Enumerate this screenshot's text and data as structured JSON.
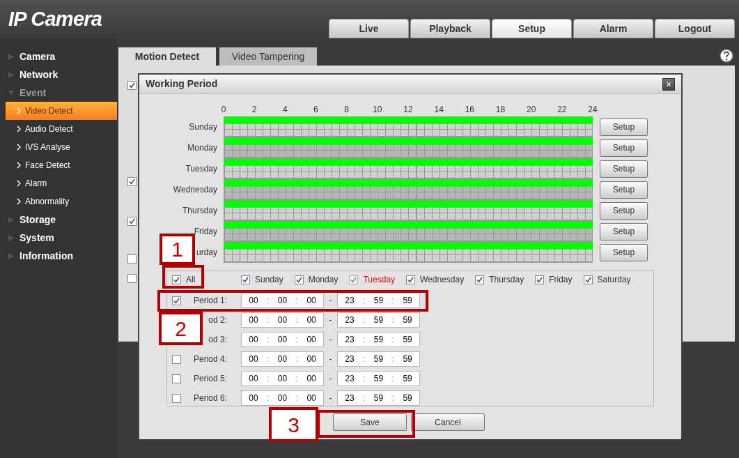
{
  "header": {
    "logo": "IP Camera",
    "nav": [
      {
        "label": "Live",
        "selected": false
      },
      {
        "label": "Playback",
        "selected": false
      },
      {
        "label": "Setup",
        "selected": true
      },
      {
        "label": "Alarm",
        "selected": false
      },
      {
        "label": "Logout",
        "selected": false
      }
    ]
  },
  "sidebar": {
    "items": [
      {
        "label": "Camera",
        "expanded": false
      },
      {
        "label": "Network",
        "expanded": false
      },
      {
        "label": "Event",
        "expanded": true,
        "children": [
          {
            "label": "Video Detect",
            "selected": true
          },
          {
            "label": "Audio Detect",
            "selected": false
          },
          {
            "label": "IVS Analyse",
            "selected": false
          },
          {
            "label": "Face Detect",
            "selected": false
          },
          {
            "label": "Alarm",
            "selected": false
          },
          {
            "label": "Abnormality",
            "selected": false
          }
        ]
      },
      {
        "label": "Storage",
        "expanded": false
      },
      {
        "label": "System",
        "expanded": false
      },
      {
        "label": "Information",
        "expanded": false
      }
    ]
  },
  "tabs": [
    {
      "label": "Motion Detect",
      "selected": true
    },
    {
      "label": "Video Tampering",
      "selected": false
    }
  ],
  "background_checkboxes": [
    {
      "checked": true
    },
    {
      "checked": true
    },
    {
      "checked": true
    },
    {
      "checked": false
    },
    {
      "checked": false
    }
  ],
  "dialog": {
    "title": "Working Period",
    "close": "×",
    "hour_labels": [
      "0",
      "2",
      "4",
      "6",
      "8",
      "10",
      "12",
      "14",
      "16",
      "18",
      "20",
      "22",
      "24"
    ],
    "days": [
      {
        "label": "Sunday",
        "button": "Setup"
      },
      {
        "label": "Monday",
        "button": "Setup"
      },
      {
        "label": "Tuesday",
        "button": "Setup"
      },
      {
        "label": "Wednesday",
        "button": "Setup"
      },
      {
        "label": "Thursday",
        "button": "Setup"
      },
      {
        "label": "Friday",
        "button": "Setup"
      },
      {
        "label": "urday",
        "button": "Setup"
      }
    ],
    "all": {
      "label": "All",
      "checked": true
    },
    "weekdays": [
      {
        "label": "Sunday",
        "checked": true,
        "current": false
      },
      {
        "label": "Monday",
        "checked": true,
        "current": false
      },
      {
        "label": "Tuesday",
        "checked": true,
        "current": true
      },
      {
        "label": "Wednesday",
        "checked": true,
        "current": false
      },
      {
        "label": "Thursday",
        "checked": true,
        "current": false
      },
      {
        "label": "Friday",
        "checked": true,
        "current": false
      },
      {
        "label": "Saturday",
        "checked": true,
        "current": false
      }
    ],
    "periods": [
      {
        "label": "Period 1:",
        "checked": true,
        "start": [
          "00",
          "00",
          "00"
        ],
        "end": [
          "23",
          "59",
          "59"
        ]
      },
      {
        "label": "od 2:",
        "start": [
          "00",
          "00",
          "00"
        ],
        "end": [
          "23",
          "59",
          "59"
        ]
      },
      {
        "label": "od 3:",
        "start": [
          "00",
          "00",
          "00"
        ],
        "end": [
          "23",
          "59",
          "59"
        ]
      },
      {
        "label": "Period 4:",
        "checked": false,
        "start": [
          "00",
          "00",
          "00"
        ],
        "end": [
          "23",
          "59",
          "59"
        ]
      },
      {
        "label": "Period 5:",
        "checked": false,
        "start": [
          "00",
          "00",
          "00"
        ],
        "end": [
          "23",
          "59",
          "59"
        ]
      },
      {
        "label": "Period 6:",
        "checked": false,
        "start": [
          "00",
          "00",
          "00"
        ],
        "end": [
          "23",
          "59",
          "59"
        ]
      }
    ],
    "time_separator": ":",
    "range_separator": "-",
    "buttons": [
      "Save",
      "Cancel"
    ]
  },
  "annotations": [
    {
      "number": "1"
    },
    {
      "number": "2"
    },
    {
      "number": "3"
    }
  ]
}
